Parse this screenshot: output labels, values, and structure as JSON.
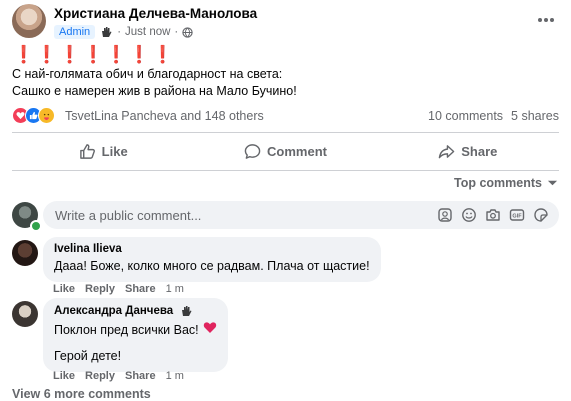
{
  "post": {
    "author": "Христиана Делчева-Манолова",
    "badge": "Admin",
    "time": "Just now",
    "bangs": "❗❗❗❗❗❗❗",
    "line1": "С най-голямата обич и благодарност на света:",
    "line2": "Сашко е намерен жив в района на Мало Бучино!",
    "reaction_text": "TsvetLina Pancheva and 148 others",
    "comments_count": "10 comments",
    "shares_count": "5 shares"
  },
  "actions": {
    "like": "Like",
    "comment": "Comment",
    "share": "Share"
  },
  "sort": {
    "label": "Top comments"
  },
  "composer": {
    "placeholder": "Write a public comment..."
  },
  "comments": [
    {
      "name": "Ivelina Ilieva",
      "text": "Дааа! Боже, колко много се радвам. Плача от щастие!",
      "like": "Like",
      "reply": "Reply",
      "share": "Share",
      "time": "1 m"
    },
    {
      "name": "Александра Данчева",
      "text": "Поклон пред всички Вас!",
      "text2": "Герой дете!",
      "like": "Like",
      "reply": "Reply",
      "share": "Share",
      "time": "1 m"
    }
  ],
  "view_more": "View 6 more comments",
  "colors": {
    "like_blue": "#1877f2",
    "love_red": "#f33e58",
    "text_gray": "#65676b",
    "bubble_bg": "#f0f2f5"
  },
  "icons": [
    "more-icon",
    "hand-icon",
    "globe-icon",
    "like-reaction-icon",
    "love-reaction-icon",
    "care-reaction-icon",
    "thumb-up-icon",
    "comment-icon",
    "share-icon",
    "chevron-down-icon",
    "sticker-icon",
    "emoji-icon",
    "camera-icon",
    "gif-icon",
    "avatar-sticker-icon",
    "red-heart-icon"
  ]
}
